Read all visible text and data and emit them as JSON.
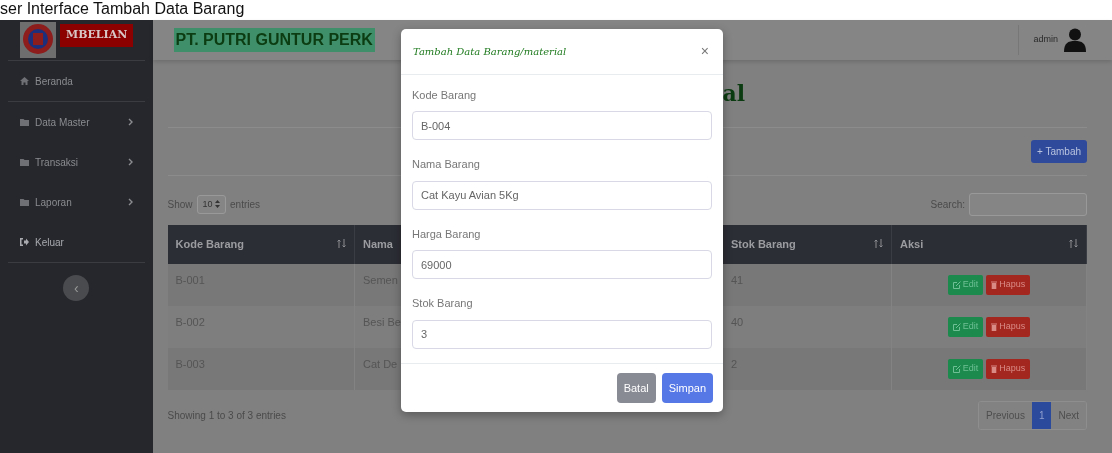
{
  "caption": "ser Interface Tambah Data Barang",
  "brand": "MBELIAN",
  "company": "PT. PUTRI GUNTUR PERK",
  "user": "admin",
  "sidebar": {
    "items": [
      {
        "label": "Beranda",
        "kind": "home"
      },
      {
        "label": "Data Master",
        "kind": "folder"
      },
      {
        "label": "Transaksi",
        "kind": "folder"
      },
      {
        "label": "Laporan",
        "kind": "folder"
      },
      {
        "label": "Keluar",
        "kind": "logout"
      }
    ],
    "toggle": "‹"
  },
  "page_title": "al",
  "add_button": "+ Tambah",
  "length_menu": {
    "before": "Show",
    "value": "10",
    "after": "entries"
  },
  "search_label": "Search:",
  "table": {
    "columns": [
      "Kode Barang",
      "Nama",
      "Stok Barang",
      "Aksi"
    ],
    "rows": [
      {
        "kode": "B-001",
        "nama": "Semen",
        "stok": "41",
        "edit": "Edit",
        "delete": "Hapus"
      },
      {
        "kode": "B-002",
        "nama": "Besi Be",
        "stok": "40",
        "edit": "Edit",
        "delete": "Hapus"
      },
      {
        "kode": "B-003",
        "nama": "Cat De",
        "stok": "2",
        "edit": "Edit",
        "delete": "Hapus"
      }
    ]
  },
  "info": "Showing 1 to 3 of 3 entries",
  "pagination": [
    {
      "label": "Previous",
      "selected": false
    },
    {
      "label": "1",
      "selected": true
    },
    {
      "label": "Next",
      "selected": false
    }
  ],
  "modal": {
    "title": "Tambah Data Barang/material",
    "close": "×",
    "fields": [
      {
        "label": "Kode Barang",
        "value": "B-004"
      },
      {
        "label": "Nama Barang",
        "value": "Cat Kayu Avian 5Kg"
      },
      {
        "label": "Harga Barang",
        "value": "69000"
      },
      {
        "label": "Stok Barang",
        "value": "3"
      }
    ],
    "buttons": [
      {
        "label": "Batal",
        "kind": "secondary"
      },
      {
        "label": "Simpan",
        "kind": "primary"
      }
    ]
  }
}
